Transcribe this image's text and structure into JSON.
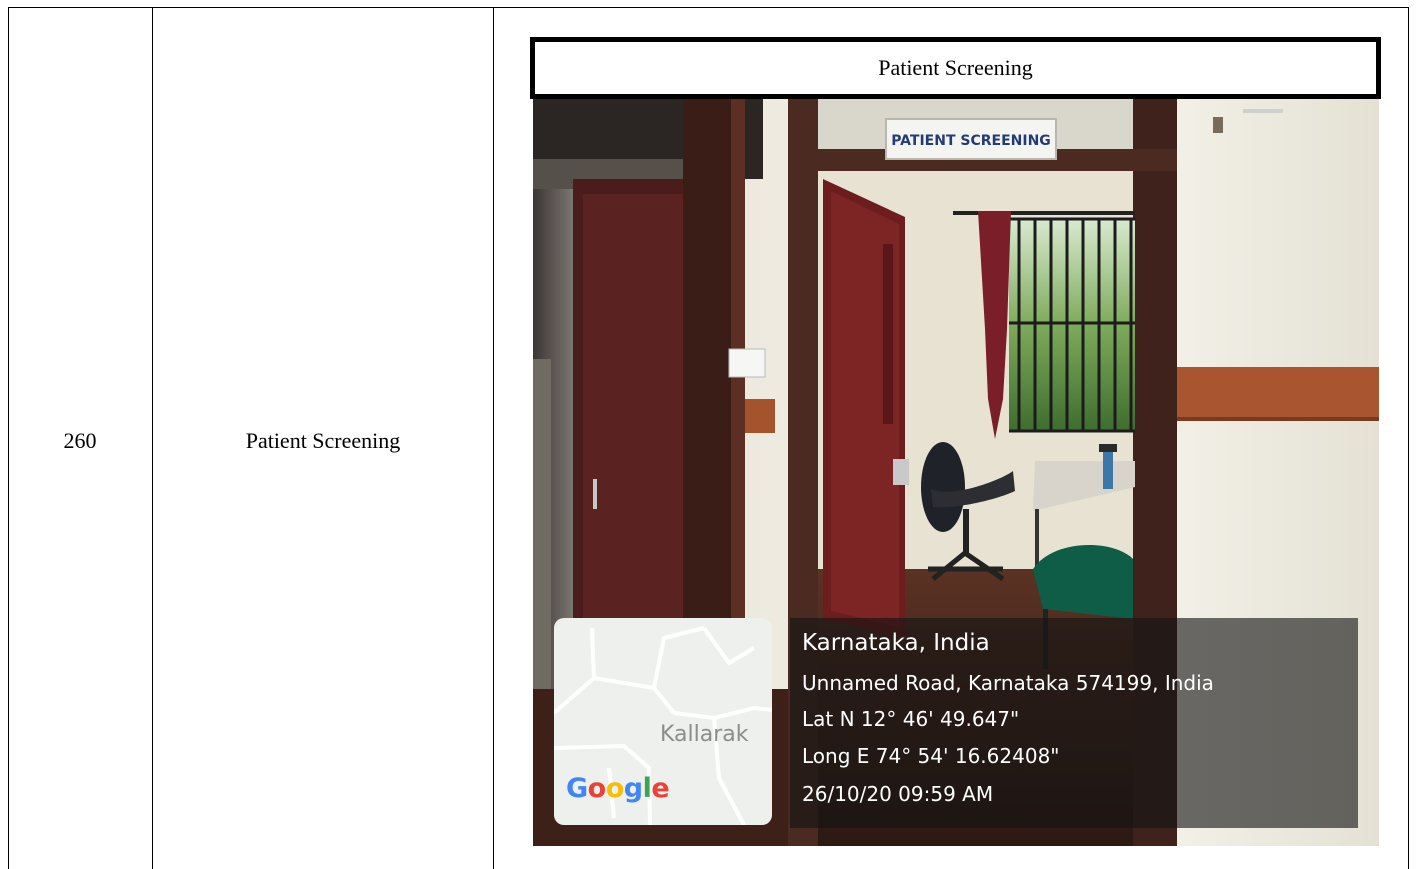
{
  "row": {
    "number": "260",
    "name": "Patient Screening"
  },
  "photo": {
    "caption": "Patient Screening",
    "door_sign": "PATIENT SCREENING",
    "map": {
      "brand": "Google",
      "brand_letters": [
        "G",
        "o",
        "o",
        "g",
        "l",
        "e"
      ],
      "brand_colors": [
        "#4285F4",
        "#EA4335",
        "#FBBC05",
        "#4285F4",
        "#34A853",
        "#EA4335"
      ],
      "town_label": "Kallarak"
    },
    "geotag": {
      "place": "Karnataka, India",
      "address": "Unnamed Road, Karnataka 574199, India",
      "latitude": "Lat N 12° 46' 49.647\"",
      "longitude": "Long E 74° 54' 16.62408\"",
      "timestamp": "26/10/20 09:59 AM"
    }
  }
}
